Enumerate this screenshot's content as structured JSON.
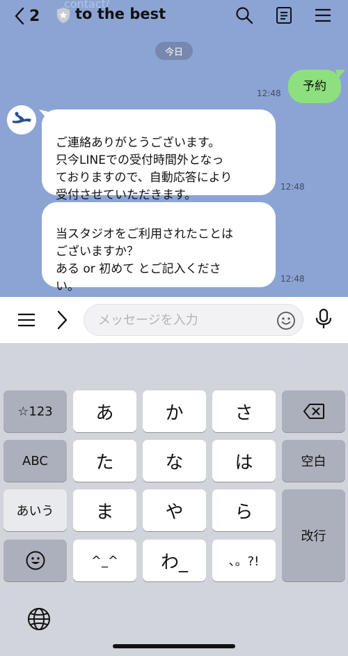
{
  "header": {
    "back_count": "2",
    "title": "to the best",
    "faint_text": "contact/"
  },
  "chat": {
    "date_label": "今日",
    "messages": [
      {
        "side": "me",
        "text": "予約",
        "time": "12:48"
      },
      {
        "side": "them",
        "text": "ご連絡ありがとうございます。\n只今LINEでの受付時間外となっ\nておりますので、自動応答により\n受付させていただきます。",
        "time": "12:48"
      },
      {
        "side": "them",
        "text": "当スタジオをご利用されたことは\nございますか？\nある or 初めて とご記入くださ\nい。",
        "time": "12:48"
      }
    ]
  },
  "input": {
    "placeholder": "メッセージを入力",
    "value": ""
  },
  "keyboard": {
    "rows": [
      [
        "☆123",
        "あ",
        "か",
        "さ",
        "delete"
      ],
      [
        "ABC",
        "た",
        "な",
        "は",
        "空白"
      ],
      [
        "あいう",
        "ま",
        "や",
        "ら",
        "改行"
      ],
      [
        "emoji",
        "^_^",
        "わ_",
        "、。?!"
      ]
    ],
    "labels": {
      "num": "☆123",
      "abc": "ABC",
      "kana": "あいう",
      "space": "空白",
      "return": "改行",
      "a": "あ",
      "ka": "か",
      "sa": "さ",
      "ta": "た",
      "na": "な",
      "ha": "は",
      "ma": "ま",
      "ya": "や",
      "ra": "ら",
      "face": "^_^",
      "wa": "わ_",
      "punct": "、。?!"
    }
  },
  "colors": {
    "chat_bg": "#8ca4d4",
    "my_bubble": "#8ee07e",
    "their_bubble": "#ffffff",
    "keyboard_bg": "#d1d4db"
  },
  "icons": [
    "chevron-left-icon",
    "shield-star-icon",
    "search-icon",
    "note-icon",
    "menu-icon",
    "hamburger-icon",
    "chevron-right-icon",
    "smiley-icon",
    "microphone-icon",
    "backspace-icon",
    "emoji-icon",
    "globe-icon"
  ]
}
